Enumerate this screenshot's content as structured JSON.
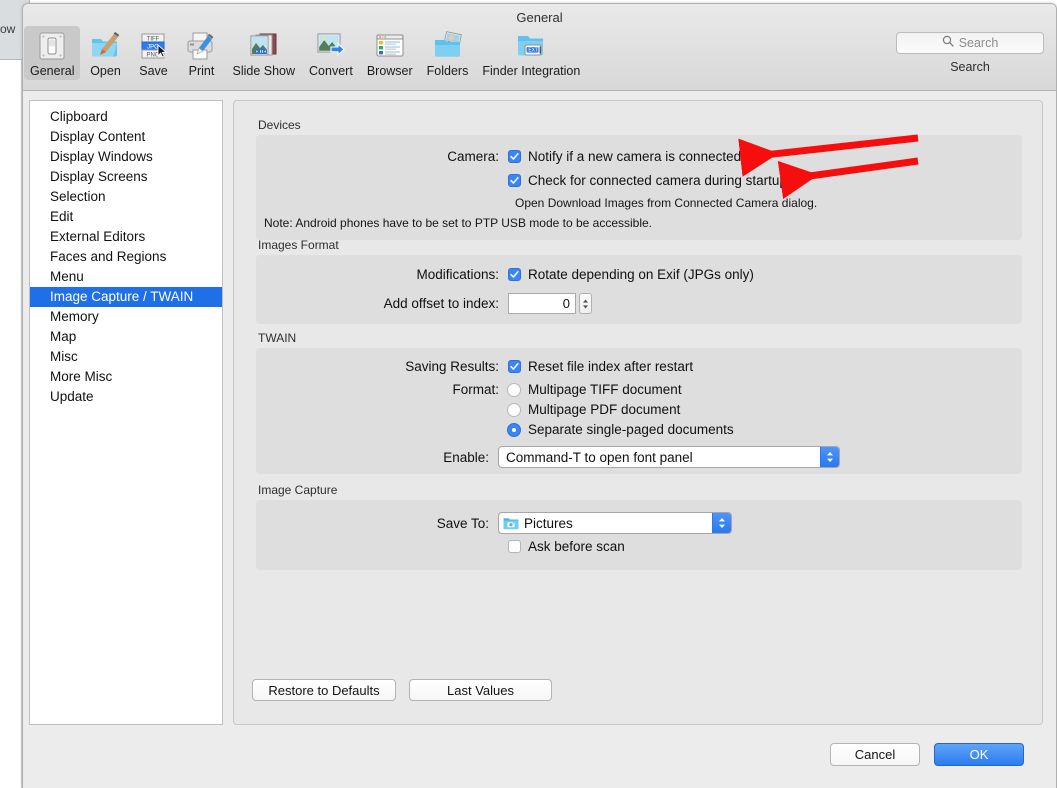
{
  "background_window": {
    "visible_text": "ow"
  },
  "window": {
    "title": "General"
  },
  "toolbar": {
    "items": [
      {
        "label": "General",
        "icon": "general-switch-icon",
        "selected": true
      },
      {
        "label": "Open",
        "icon": "open-folder-brush-icon",
        "selected": false
      },
      {
        "label": "Save",
        "icon": "save-formats-icon",
        "selected": false
      },
      {
        "label": "Print",
        "icon": "printer-icon",
        "selected": false
      },
      {
        "label": "Slide Show",
        "icon": "slideshow-icon",
        "selected": false
      },
      {
        "label": "Convert",
        "icon": "convert-arrow-icon",
        "selected": false
      },
      {
        "label": "Browser",
        "icon": "browser-list-icon",
        "selected": false
      },
      {
        "label": "Folders",
        "icon": "folders-photo-icon",
        "selected": false
      },
      {
        "label": "Finder Integration",
        "icon": "finder-ext-icon",
        "selected": false
      }
    ]
  },
  "search": {
    "placeholder": "Search",
    "value": "",
    "caption": "Search",
    "icon": "search-icon"
  },
  "sidebar": {
    "items": [
      {
        "label": "Clipboard",
        "selected": false
      },
      {
        "label": "Display Content",
        "selected": false
      },
      {
        "label": "Display Windows",
        "selected": false
      },
      {
        "label": "Display Screens",
        "selected": false
      },
      {
        "label": "Selection",
        "selected": false
      },
      {
        "label": "Edit",
        "selected": false
      },
      {
        "label": "External Editors",
        "selected": false
      },
      {
        "label": "Faces and Regions",
        "selected": false
      },
      {
        "label": "Menu",
        "selected": false
      },
      {
        "label": "Image Capture / TWAIN",
        "selected": true
      },
      {
        "label": "Memory",
        "selected": false
      },
      {
        "label": "Map",
        "selected": false
      },
      {
        "label": "Misc",
        "selected": false
      },
      {
        "label": "More Misc",
        "selected": false
      },
      {
        "label": "Update",
        "selected": false
      }
    ]
  },
  "devices": {
    "group_title": "Devices",
    "camera_label": "Camera:",
    "notify_checkbox": {
      "label": "Notify if a new camera is connected",
      "checked": true
    },
    "startup_checkbox": {
      "label": "Check for connected camera during startup",
      "checked": true
    },
    "hint": "Open Download Images from Connected Camera dialog.",
    "note": "Note: Android phones have to be set to PTP USB mode to be accessible."
  },
  "images_format": {
    "group_title": "Images Format",
    "modifications_label": "Modifications:",
    "rotate_checkbox": {
      "label": "Rotate depending on Exif (JPGs only)",
      "checked": true
    },
    "offset_label": "Add offset to index:",
    "offset_value": "0"
  },
  "twain": {
    "group_title": "TWAIN",
    "saving_results_label": "Saving Results:",
    "reset_checkbox": {
      "label": "Reset file index after restart",
      "checked": true
    },
    "format_label": "Format:",
    "format_options": [
      {
        "label": "Multipage TIFF document",
        "selected": false
      },
      {
        "label": "Multipage PDF document",
        "selected": false
      },
      {
        "label": "Separate single-paged documents",
        "selected": true
      }
    ],
    "enable_label": "Enable:",
    "enable_value": "Command-T to open font panel"
  },
  "image_capture": {
    "group_title": "Image Capture",
    "save_to_label": "Save To:",
    "save_to_value": "Pictures",
    "save_to_icon": "pictures-folder-icon",
    "ask_checkbox": {
      "label": "Ask before scan",
      "checked": false
    }
  },
  "buttons": {
    "restore_defaults": "Restore to Defaults",
    "last_values": "Last Values",
    "cancel": "Cancel",
    "ok": "OK"
  },
  "annotations": {
    "arrow_color": "#f60d0d",
    "arrows": [
      {
        "name": "arrow-to-notify-checkbox"
      },
      {
        "name": "arrow-to-startup-checkbox"
      }
    ]
  },
  "colors": {
    "accent": "#3b85f4",
    "selection": "#1e6fe8",
    "primary_button": "#2b7cf0",
    "annotation_red": "#f60d0d"
  }
}
